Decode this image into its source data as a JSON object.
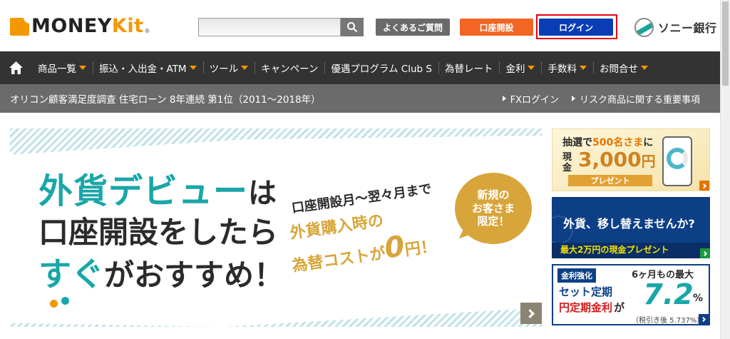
{
  "header": {
    "logo_main": "MONEY",
    "logo_accent": "Kit",
    "logo_reg": "®",
    "search_placeholder": "",
    "faq_label": "よくあるご質問",
    "open_account_label": "口座開設",
    "login_label": "ログイン",
    "bank_name": "ソニー銀行"
  },
  "nav": {
    "items": [
      {
        "label": "商品一覧",
        "dropdown": true
      },
      {
        "label": "振込・入出金・ATM",
        "dropdown": true
      },
      {
        "label": "ツール",
        "dropdown": true
      },
      {
        "label": "キャンペーン",
        "dropdown": false
      },
      {
        "label": "優遇プログラム Club S",
        "dropdown": false
      },
      {
        "label": "為替レート",
        "dropdown": false
      },
      {
        "label": "金利",
        "dropdown": true
      },
      {
        "label": "手数料",
        "dropdown": true
      },
      {
        "label": "お問合せ",
        "dropdown": true
      }
    ]
  },
  "subbar": {
    "title": "オリコン顧客満足度調査 住宅ローン 8年連続 第1位（2011～2018年）",
    "links": [
      "FXログイン",
      "リスク商品に関する重要事項"
    ]
  },
  "banner": {
    "line1_a": "外貨デビュー",
    "line1_b": "は",
    "line2": "口座開設をしたら",
    "line3_a": "すぐ",
    "line3_b": "がおすすめ！",
    "right1": "口座開設月～翌々月まで",
    "right2": "外貨購入時の",
    "right3_a": "為替コストが",
    "right3_zero": "0",
    "right3_b": "円！",
    "badge1": "新規の",
    "badge2": "お客さま",
    "badge3": "限定！"
  },
  "side1": {
    "t1_a": "抽選で",
    "t1_b": "500名さま",
    "t1_c": "に",
    "t2": "現金",
    "amount": "3,000",
    "yen": "円",
    "ribbon": "プレゼント"
  },
  "side2": {
    "t1": "外貨、移し替えませんか?",
    "t2": "最大2万円の現金プレゼント"
  },
  "side3": {
    "tag": "金利強化",
    "t1": "6ヶ月もの最大",
    "t2": "セット定期",
    "t3_a": "円定期金利",
    "t3_b": "が",
    "rate": "7.2",
    "pct": "%",
    "note": "（税引き後 5.737%）"
  },
  "colors": {
    "brand_orange": "#f39800",
    "nav_bg": "#333333",
    "login_blue": "#0a3db5",
    "teal": "#1aa6a8"
  }
}
